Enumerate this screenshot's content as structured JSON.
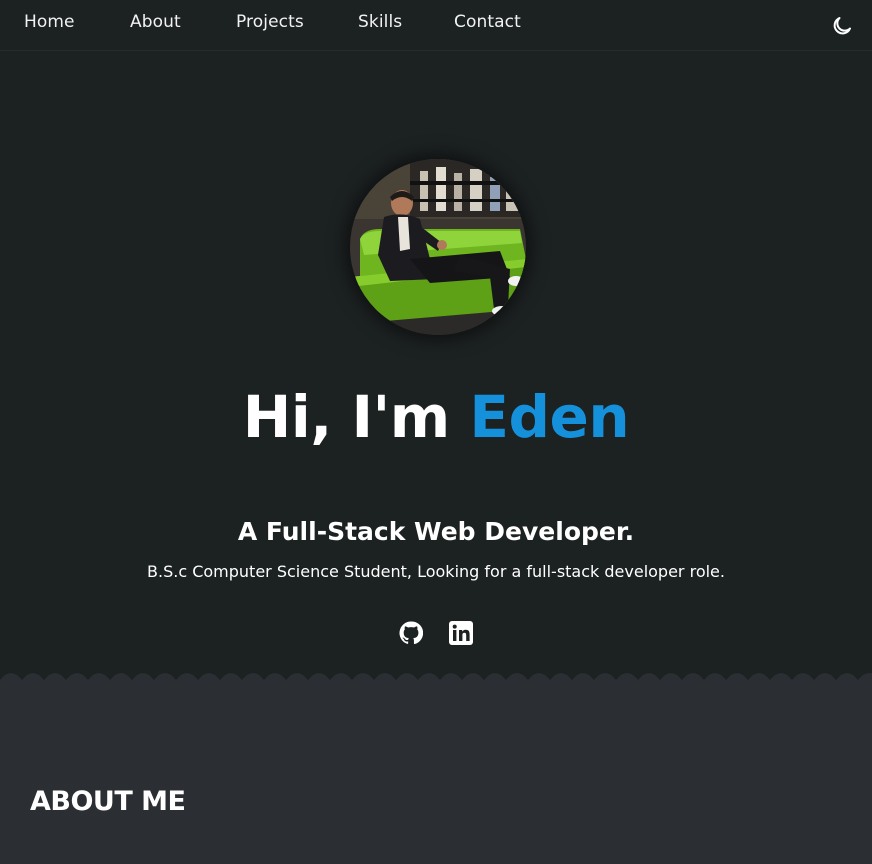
{
  "nav": {
    "items": [
      {
        "label": "Home"
      },
      {
        "label": "About"
      },
      {
        "label": "Projects"
      },
      {
        "label": "Skills"
      },
      {
        "label": "Contact"
      }
    ],
    "theme_toggle_icon": "moon-icon"
  },
  "hero": {
    "greeting": "Hi, I'm ",
    "name": "Eden",
    "subtitle": "A Full-Stack Web Developer.",
    "description": "B.S.c Computer Science Student, Looking for a full-stack developer role.",
    "socials": [
      {
        "icon": "github-icon"
      },
      {
        "icon": "linkedin-icon"
      }
    ]
  },
  "about": {
    "title": "ABOUT ME"
  },
  "colors": {
    "background": "#1c2121",
    "section_background": "#2b2e32",
    "accent": "#1591dc",
    "text": "#ffffff"
  }
}
